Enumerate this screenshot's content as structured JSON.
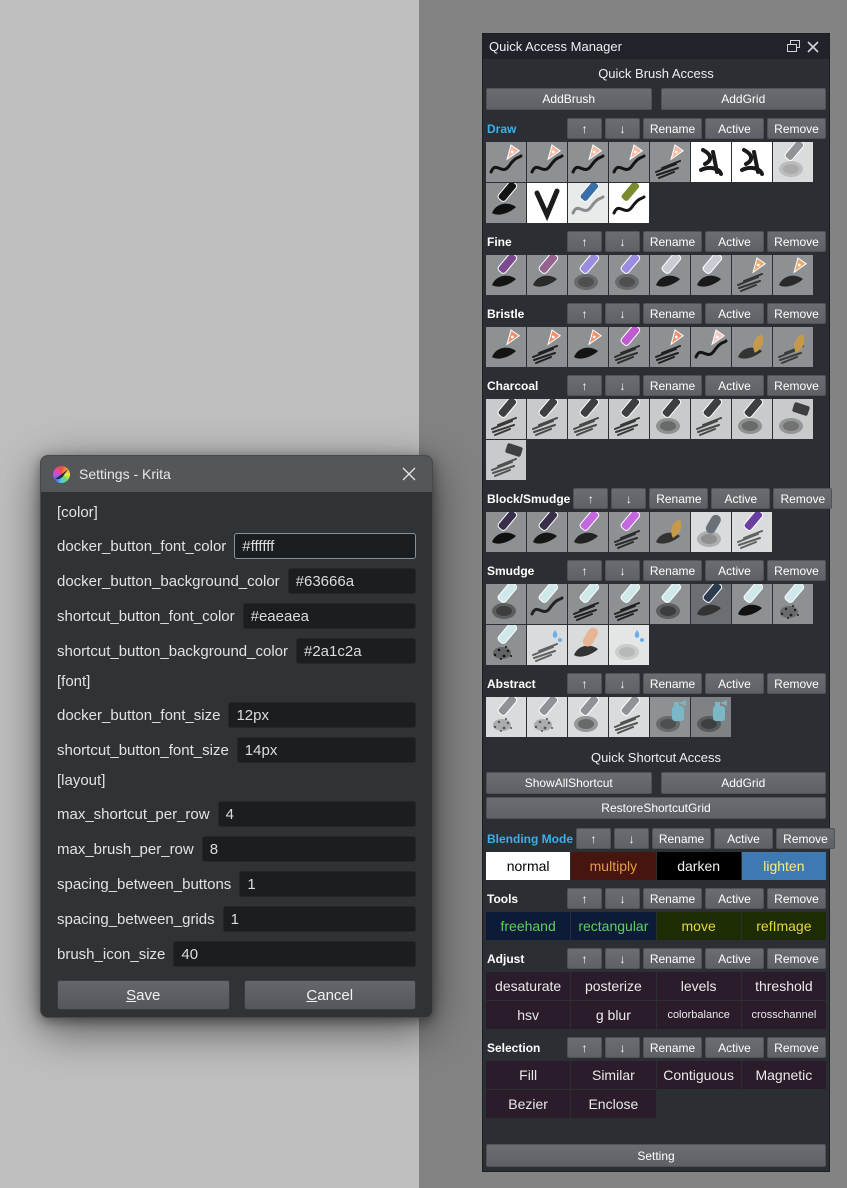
{
  "canvas": {
    "background": "#bfbfbf"
  },
  "docker": {
    "title": "Quick Access Manager",
    "brush_section_title": "Quick Brush Access",
    "brush_actions": [
      "AddBrush",
      "AddGrid"
    ],
    "group_controls": [
      "↑",
      "↓",
      "Rename",
      "Active",
      "Remove"
    ],
    "brush_groups": [
      {
        "label": "Draw",
        "active": true,
        "tiles": [
          [
            "#8e9194",
            "squiggle",
            "#141414",
            "nib",
            "#f5b8a0"
          ],
          [
            "#8e9194",
            "squiggle",
            "#141414",
            "nib",
            "#f5b8a0"
          ],
          [
            "#8e9194",
            "squiggle",
            "#141414",
            "nib",
            "#f5b8a0"
          ],
          [
            "#8e9194",
            "squiggle",
            "#141414",
            "nib",
            "#f5b8a0"
          ],
          [
            "#8e9194",
            "texture",
            "#141414",
            "nib",
            "#f5b8a0"
          ],
          [
            "#ffffff",
            "glyph",
            "#1a1a1a",
            "none",
            ""
          ],
          [
            "#ffffff",
            "glyph",
            "#1a1a1a",
            "none",
            ""
          ],
          [
            "#d9dbdc",
            "soft",
            "#9a9a9a",
            "stick",
            "#8f9296"
          ],
          [
            "#8e9194",
            "blob",
            "#101010",
            "stick",
            "#141414"
          ],
          [
            "#ffffff",
            "v",
            "#1c1c1c",
            "none",
            ""
          ],
          [
            "#e9eaea",
            "squiggle",
            "#8a8d90",
            "stick",
            "#3a6ea8"
          ],
          [
            "#ffffff",
            "squiggle",
            "#161616",
            "stick",
            "#7a8a2e"
          ]
        ]
      },
      {
        "label": "Fine",
        "active": false,
        "tiles": [
          [
            "#8e9194",
            "blob",
            "#141414",
            "stick",
            "#7b4a8f"
          ],
          [
            "#8e9194",
            "blob",
            "#2a2a2a",
            "stick",
            "#96628f"
          ],
          [
            "#8e9194",
            "soft",
            "#3a3a3a",
            "stick",
            "#9b8ce0"
          ],
          [
            "#8e9194",
            "soft",
            "#3a3a3a",
            "stick",
            "#9b8ce0"
          ],
          [
            "#8e9194",
            "blob",
            "#1a1a1a",
            "stick",
            "#c9ccd4"
          ],
          [
            "#8e9194",
            "blob",
            "#1a1a1a",
            "stick",
            "#c9ccd4"
          ],
          [
            "#8e9194",
            "texture",
            "#2a2a2a",
            "nib",
            "#e8a96b"
          ],
          [
            "#8e9194",
            "blob",
            "#2a2a2a",
            "nib",
            "#e8a96b"
          ]
        ]
      },
      {
        "label": "Bristle",
        "active": false,
        "tiles": [
          [
            "#8e9194",
            "blob",
            "#141414",
            "nib",
            "#f08f6a"
          ],
          [
            "#8e9194",
            "texture",
            "#141414",
            "nib",
            "#f08f6a"
          ],
          [
            "#8e9194",
            "blob",
            "#141414",
            "nib",
            "#f08f6a"
          ],
          [
            "#8e9194",
            "texture",
            "#222222",
            "stick",
            "#c05ad0"
          ],
          [
            "#8e9194",
            "texture",
            "#141414",
            "nib",
            "#f08f6a"
          ],
          [
            "#8e9194",
            "squiggle",
            "#141414",
            "nib",
            "#f8c8c0"
          ],
          [
            "#8e9194",
            "blob",
            "#333333",
            "leaf",
            "#c79a4b"
          ],
          [
            "#8e9194",
            "texture",
            "#333333",
            "leaf",
            "#c79a4b"
          ]
        ]
      },
      {
        "label": "Charcoal",
        "active": false,
        "tiles": [
          [
            "#c8cacb",
            "texture",
            "#2a2a2a",
            "stick",
            "#3c4043"
          ],
          [
            "#c8cacb",
            "texture",
            "#3a3a3a",
            "stick",
            "#3c4043"
          ],
          [
            "#c8cacb",
            "texture",
            "#3a3a3a",
            "stick",
            "#3c4043"
          ],
          [
            "#c8cacb",
            "texture",
            "#2a2a2a",
            "stick",
            "#3c4043"
          ],
          [
            "#c8cacb",
            "soft",
            "#4a4a4a",
            "stick",
            "#3c4043"
          ],
          [
            "#c8cacb",
            "texture",
            "#3a3a3a",
            "stick",
            "#3c4043"
          ],
          [
            "#c8cacb",
            "soft",
            "#4a4a4a",
            "stick",
            "#3c4043"
          ],
          [
            "#c8cacb",
            "soft",
            "#555555",
            "block",
            "#3c4043"
          ],
          [
            "#c8cacb",
            "texture",
            "#444444",
            "block",
            "#3c4043"
          ]
        ]
      },
      {
        "label": "Block/Smudge",
        "active": false,
        "tiles": [
          [
            "#8e9194",
            "blob",
            "#101010",
            "stick",
            "#3a2f4a"
          ],
          [
            "#8e9194",
            "blob",
            "#161616",
            "stick",
            "#3a2f4a"
          ],
          [
            "#8e9194",
            "blob",
            "#222222",
            "stick",
            "#c468e0"
          ],
          [
            "#8e9194",
            "texture",
            "#222222",
            "stick",
            "#c468e0"
          ],
          [
            "#8e9194",
            "blob",
            "#333333",
            "leaf",
            "#c79a4b"
          ],
          [
            "#d9dbdc",
            "soft",
            "#777777",
            "finger",
            "#6a7078"
          ],
          [
            "#d9dbdc",
            "texture",
            "#555555",
            "stick",
            "#6a3fa0"
          ]
        ]
      },
      {
        "label": "Smudge",
        "active": false,
        "tiles": [
          [
            "#8e9194",
            "soft",
            "#222222",
            "stick",
            "#cfe8ea"
          ],
          [
            "#8e9194",
            "squiggle",
            "#222222",
            "stick",
            "#cfe8ea"
          ],
          [
            "#8e9194",
            "texture",
            "#161616",
            "stick",
            "#cfe8ea"
          ],
          [
            "#8e9194",
            "texture",
            "#161616",
            "stick",
            "#cfe8ea"
          ],
          [
            "#8e9194",
            "soft",
            "#222222",
            "stick",
            "#cfe8ea"
          ],
          [
            "#6b6f73",
            "blob",
            "#333333",
            "stick",
            "#2a3b52"
          ],
          [
            "#8e9194",
            "blob",
            "#111111",
            "stick",
            "#cfe8ea"
          ],
          [
            "#8e9194",
            "spray",
            "#222222",
            "stick",
            "#cfe8ea"
          ],
          [
            "#8e9194",
            "spray",
            "#111111",
            "stick",
            "#cfe8ea"
          ],
          [
            "#d9dbdc",
            "texture",
            "#555555",
            "drop",
            "#6ab0e8"
          ],
          [
            "#d9dbdc",
            "blob",
            "#333333",
            "finger",
            "#e8b493"
          ],
          [
            "#e4e5e5",
            "soft",
            "#aaaaaa",
            "drop",
            "#6ab0e8"
          ]
        ]
      },
      {
        "label": "Abstract",
        "active": false,
        "tiles": [
          [
            "#d9dbdc",
            "spray",
            "#555555",
            "stick",
            "#8f9397"
          ],
          [
            "#d9dbdc",
            "spray",
            "#555555",
            "stick",
            "#8f9397"
          ],
          [
            "#d9dbdc",
            "soft",
            "#444444",
            "stick",
            "#8f9397"
          ],
          [
            "#d9dbdc",
            "texture",
            "#444444",
            "stick",
            "#8f9397"
          ],
          [
            "#8e9194",
            "soft",
            "#3a3a3a",
            "can",
            "#7ab8c8"
          ],
          [
            "#7f8285",
            "soft",
            "#2a2a2a",
            "can",
            "#7ab8c8"
          ]
        ]
      }
    ],
    "shortcut_section_title": "Quick Shortcut Access",
    "shortcut_actions": [
      "ShowAllShortcut",
      "AddGrid"
    ],
    "shortcut_restore": "RestoreShortcutGrid",
    "shortcut_groups": [
      {
        "label": "Blending Mode",
        "active": true,
        "buttons": [
          {
            "text": "normal",
            "bg": "#ffffff",
            "fg": "#000000"
          },
          {
            "text": "multiply",
            "bg": "#47150f",
            "fg": "#e89c3f"
          },
          {
            "text": "darken",
            "bg": "#000000",
            "fg": "#f0f0f0"
          },
          {
            "text": "lighten",
            "bg": "#3d7ab1",
            "fg": "#ffe97a"
          }
        ]
      },
      {
        "label": "Tools",
        "active": false,
        "buttons": [
          {
            "text": "freehand",
            "bg": "#0e1b38",
            "fg": "#5ad05a"
          },
          {
            "text": "rectangular",
            "bg": "#0e1b38",
            "fg": "#5ad05a"
          },
          {
            "text": "move",
            "bg": "#1e2c04",
            "fg": "#e6d83c"
          },
          {
            "text": "refImage",
            "bg": "#1e2c04",
            "fg": "#e6d83c"
          }
        ]
      },
      {
        "label": "Adjust",
        "active": false,
        "buttons": [
          {
            "text": "desaturate"
          },
          {
            "text": "posterize"
          },
          {
            "text": "levels"
          },
          {
            "text": "threshold"
          },
          {
            "text": "hsv"
          },
          {
            "text": "g blur"
          },
          {
            "text": "colorbalance",
            "small": true
          },
          {
            "text": "crosschannel",
            "small": true
          }
        ]
      },
      {
        "label": "Selection",
        "active": false,
        "buttons": [
          {
            "text": "Fill"
          },
          {
            "text": "Similar"
          },
          {
            "text": "Contiguous"
          },
          {
            "text": "Magnetic"
          },
          {
            "text": "Bezier"
          },
          {
            "text": "Enclose"
          }
        ]
      }
    ],
    "footer_button": "Setting",
    "colors": {
      "docker_button_bg": "#63666a",
      "docker_button_font": "#ffffff",
      "shortcut_bg": "#2a1c2a",
      "shortcut_font": "#eaeaea",
      "active_label": "#3daee9"
    }
  },
  "dialog": {
    "title": "Settings - Krita",
    "sections": [
      {
        "header": "[color]",
        "fields": [
          {
            "label": "docker_button_font_color",
            "value": "#ffffff",
            "focused": true
          },
          {
            "label": "docker_button_background_color",
            "value": "#63666a"
          },
          {
            "label": "shortcut_button_font_color",
            "value": "#eaeaea"
          },
          {
            "label": "shortcut_button_background_color",
            "value": "#2a1c2a"
          }
        ]
      },
      {
        "header": "[font]",
        "fields": [
          {
            "label": "docker_button_font_size",
            "value": "12px"
          },
          {
            "label": "shortcut_button_font_size",
            "value": "14px"
          }
        ]
      },
      {
        "header": "[layout]",
        "fields": [
          {
            "label": "max_shortcut_per_row",
            "value": "4"
          },
          {
            "label": "max_brush_per_row",
            "value": "8"
          },
          {
            "label": "spacing_between_buttons",
            "value": "1"
          },
          {
            "label": "spacing_between_grids",
            "value": "1"
          },
          {
            "label": "brush_icon_size",
            "value": "40"
          }
        ]
      }
    ],
    "save_label": "Save",
    "cancel_label": "Cancel"
  }
}
